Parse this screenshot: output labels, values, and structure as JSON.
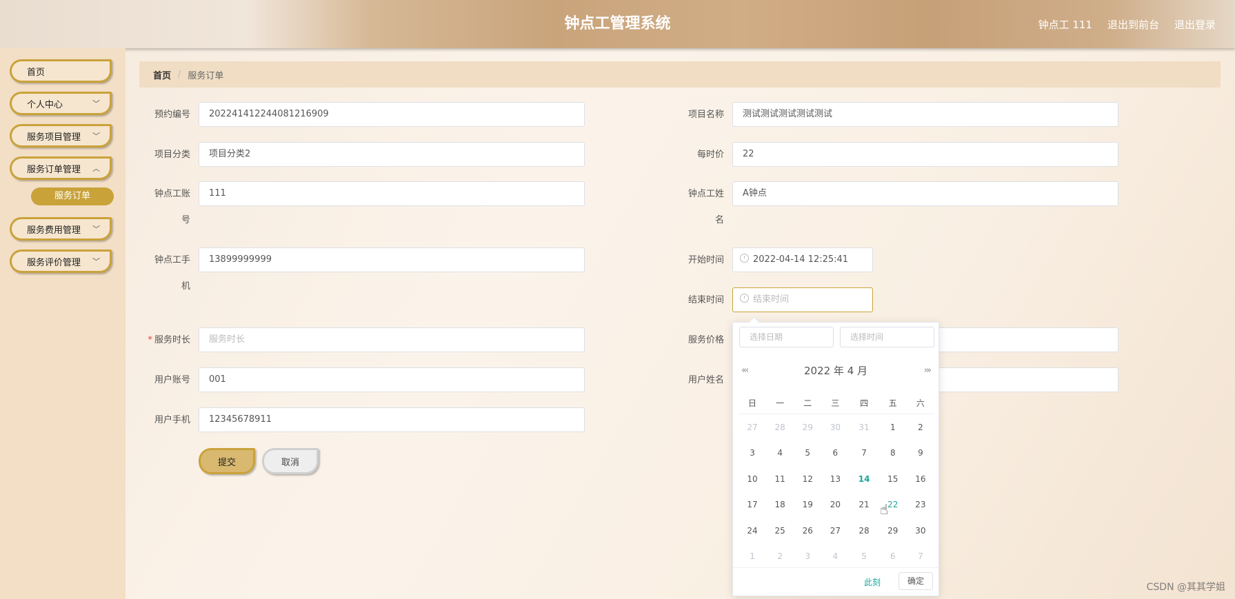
{
  "header": {
    "title": "钟点工管理系统",
    "user": "钟点工 111",
    "to_front": "退出到前台",
    "logout": "退出登录"
  },
  "sidebar": {
    "items": [
      {
        "label": "首页"
      },
      {
        "label": "个人中心"
      },
      {
        "label": "服务项目管理"
      },
      {
        "label": "服务订单管理"
      },
      {
        "label": "服务费用管理"
      },
      {
        "label": "服务评价管理"
      }
    ],
    "sub_item": "服务订单"
  },
  "breadcrumb": {
    "home": "首页",
    "sep": "/",
    "current": "服务订单"
  },
  "form": {
    "order_no": {
      "label": "预约编号",
      "value": "202241412244081216909"
    },
    "project_name": {
      "label": "项目名称",
      "value": "测试测试测试测试测试"
    },
    "category": {
      "label": "项目分类",
      "value": "项目分类2"
    },
    "hourly_price": {
      "label": "每时价",
      "value": "22"
    },
    "worker_account": {
      "label_1": "钟点工账",
      "label_2": "号",
      "value": "111"
    },
    "worker_name": {
      "label_1": "钟点工姓",
      "label_2": "名",
      "value": "A钟点"
    },
    "worker_phone": {
      "label_1": "钟点工手",
      "label_2": "机",
      "value": "13899999999"
    },
    "start_time": {
      "label": "开始时间",
      "value": "2022-04-14 12:25:41"
    },
    "end_time": {
      "label": "结束时间",
      "placeholder": "结束时间"
    },
    "duration": {
      "label": "服务时长",
      "placeholder": "服务时长",
      "required_mark": "*"
    },
    "price": {
      "label": "服务价格"
    },
    "user_account": {
      "label": "用户账号",
      "value": "001"
    },
    "user_name": {
      "label": "用户姓名"
    },
    "user_phone": {
      "label": "用户手机",
      "value": "12345678911"
    },
    "submit": "提交",
    "cancel": "取消"
  },
  "datepicker": {
    "date_placeholder": "选择日期",
    "time_placeholder": "选择时间",
    "prev": "«‹",
    "next": "›»",
    "header": "2022 年  4 月",
    "weekdays": [
      "日",
      "一",
      "二",
      "三",
      "四",
      "五",
      "六"
    ],
    "weeks": [
      [
        "27",
        "28",
        "29",
        "30",
        "31",
        "1",
        "2"
      ],
      [
        "3",
        "4",
        "5",
        "6",
        "7",
        "8",
        "9"
      ],
      [
        "10",
        "11",
        "12",
        "13",
        "14",
        "15",
        "16"
      ],
      [
        "17",
        "18",
        "19",
        "20",
        "21",
        "22",
        "23"
      ],
      [
        "24",
        "25",
        "26",
        "27",
        "28",
        "29",
        "30"
      ],
      [
        "1",
        "2",
        "3",
        "4",
        "5",
        "6",
        "7"
      ]
    ],
    "now": "此刻",
    "confirm": "确定"
  },
  "watermark": "CSDN @其其学姐",
  "colors": {
    "accent": "#c9a23a",
    "today": "#1aa899"
  }
}
